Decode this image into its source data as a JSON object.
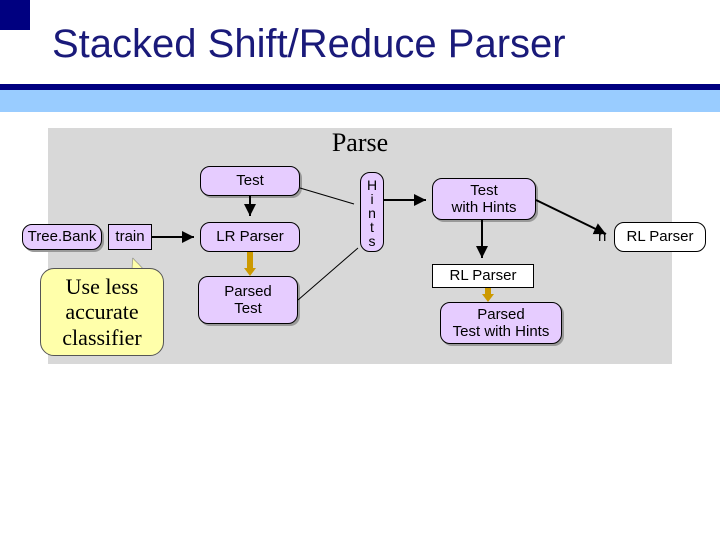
{
  "title": "Stacked Shift/Reduce Parser",
  "parse_label": "Parse",
  "nodes": {
    "treebank": "Tree.Bank",
    "train": "train",
    "test": "Test",
    "lr_parser": "LR Parser",
    "parsed_test": "Parsed\nTest",
    "hints": "H\ni\nn\nt\ns",
    "test_with_hints": "Test\nwith Hints",
    "rl_parser": "RL Parser",
    "parsed_test_hints": "Parsed\nTest with Hints",
    "stray": "n"
  },
  "callout": "Use less\naccurate\nclassifier"
}
